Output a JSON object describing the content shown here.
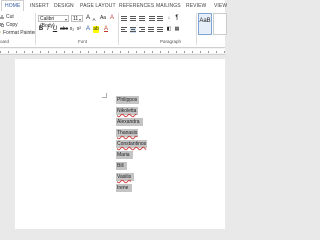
{
  "tabs": [
    {
      "label": "HOME",
      "active": true
    },
    {
      "label": "INSERT"
    },
    {
      "label": "DESIGN"
    },
    {
      "label": "PAGE LAYOUT"
    },
    {
      "label": "REFERENCES"
    },
    {
      "label": "MAILINGS"
    },
    {
      "label": "REVIEW"
    },
    {
      "label": "VIEW"
    }
  ],
  "clipboard": {
    "cut": "Cut",
    "copy": "Copy",
    "format_painter": "Format Painter",
    "group_label": "oard"
  },
  "font": {
    "name": "Calibri (Body)",
    "size": "11",
    "group_label": "Font",
    "bold": "B",
    "italic": "I",
    "underline": "U",
    "grow": "A",
    "shrink": "A",
    "case": "Aa",
    "color_a": "A"
  },
  "paragraph": {
    "group_label": "Paragraph"
  },
  "styles": {
    "first": "AaB"
  },
  "document": {
    "names": [
      "Philippos",
      "Nikoletta",
      "Alexandra",
      "Thanasis",
      "Constantinos",
      "Maria",
      "Bill",
      "Vasilis",
      "Irene"
    ],
    "highlight_color": "#c4c4c4",
    "spell_underlined": [
      "Nikoletta",
      "Thanasis",
      "Constantinos",
      "Vasilis"
    ]
  },
  "colors": {
    "accent": "#2b579a",
    "ribbon_bg": "#ffffff",
    "canvas_bg": "#e9e9e9"
  }
}
